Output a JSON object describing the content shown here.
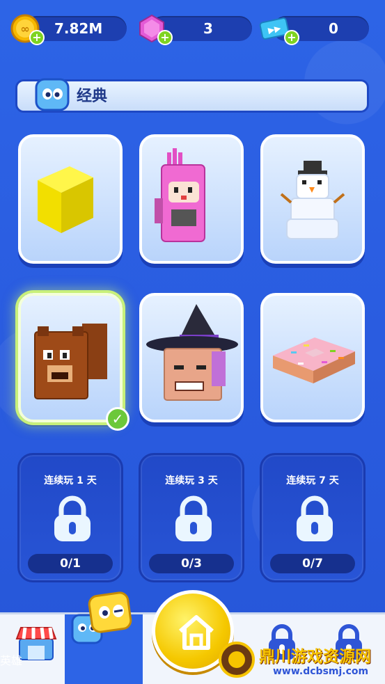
{
  "currency": {
    "coins": "7.82M",
    "gems": "3",
    "tickets": "0"
  },
  "banner": {
    "title": "经典"
  },
  "unlock_cards": [
    {
      "requirement": "连续玩 1 天",
      "progress": "0/1"
    },
    {
      "requirement": "连续玩 3 天",
      "progress": "0/3"
    },
    {
      "requirement": "连续玩 7 天",
      "progress": "0/7"
    }
  ],
  "nav": {
    "hero_label": "英雄"
  },
  "watermark": {
    "title": "鼎川游戏资源网",
    "url": "www.dcbsmj.com"
  },
  "colors": {
    "background": "#2a5fe0",
    "selected_glow": "#c8f07a",
    "check": "#6cc83a",
    "home_button": "#f5c800"
  }
}
